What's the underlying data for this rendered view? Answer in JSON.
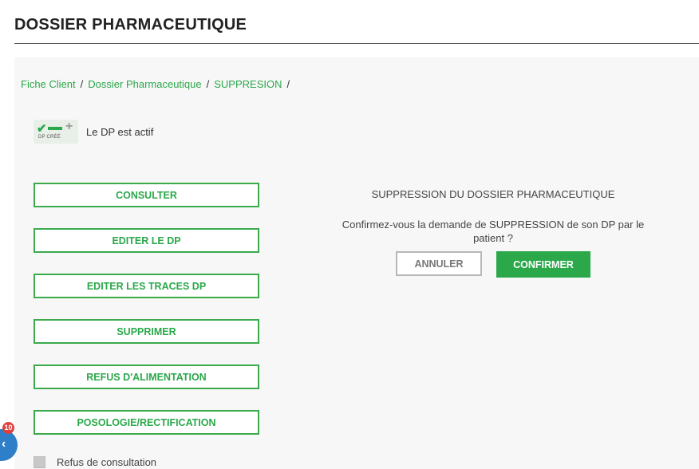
{
  "header": {
    "title": "DOSSIER PHARMACEUTIQUE"
  },
  "breadcrumb": {
    "items": [
      "Fiche Client",
      "Dossier Pharmaceutique",
      "SUPPRESION"
    ],
    "separator": "/"
  },
  "status": {
    "icon_caption": "DP CRÉÉ",
    "text": "Le DP est actif"
  },
  "actions": [
    {
      "label": "CONSULTER"
    },
    {
      "label": "EDITER LE DP"
    },
    {
      "label": "EDITER LES TRACES DP"
    },
    {
      "label": "SUPPRIMER"
    },
    {
      "label": "REFUS D'ALIMENTATION"
    },
    {
      "label": "POSOLOGIE/RECTIFICATION"
    }
  ],
  "refus": {
    "label": "Refus de consultation",
    "checked": false
  },
  "confirm": {
    "title": "SUPPRESSION DU DOSSIER PHARMACEUTIQUE",
    "question": "Confirmez-vous la demande de SUPPRESSION de son DP par le patient ?",
    "cancel_label": "ANNULER",
    "confirm_label": "CONFIRMER"
  },
  "widget": {
    "badge": "10"
  },
  "colors": {
    "accent": "#2aa84a",
    "border": "#3aaa4b",
    "widget": "#2f7ec8",
    "badge": "#e04040"
  }
}
